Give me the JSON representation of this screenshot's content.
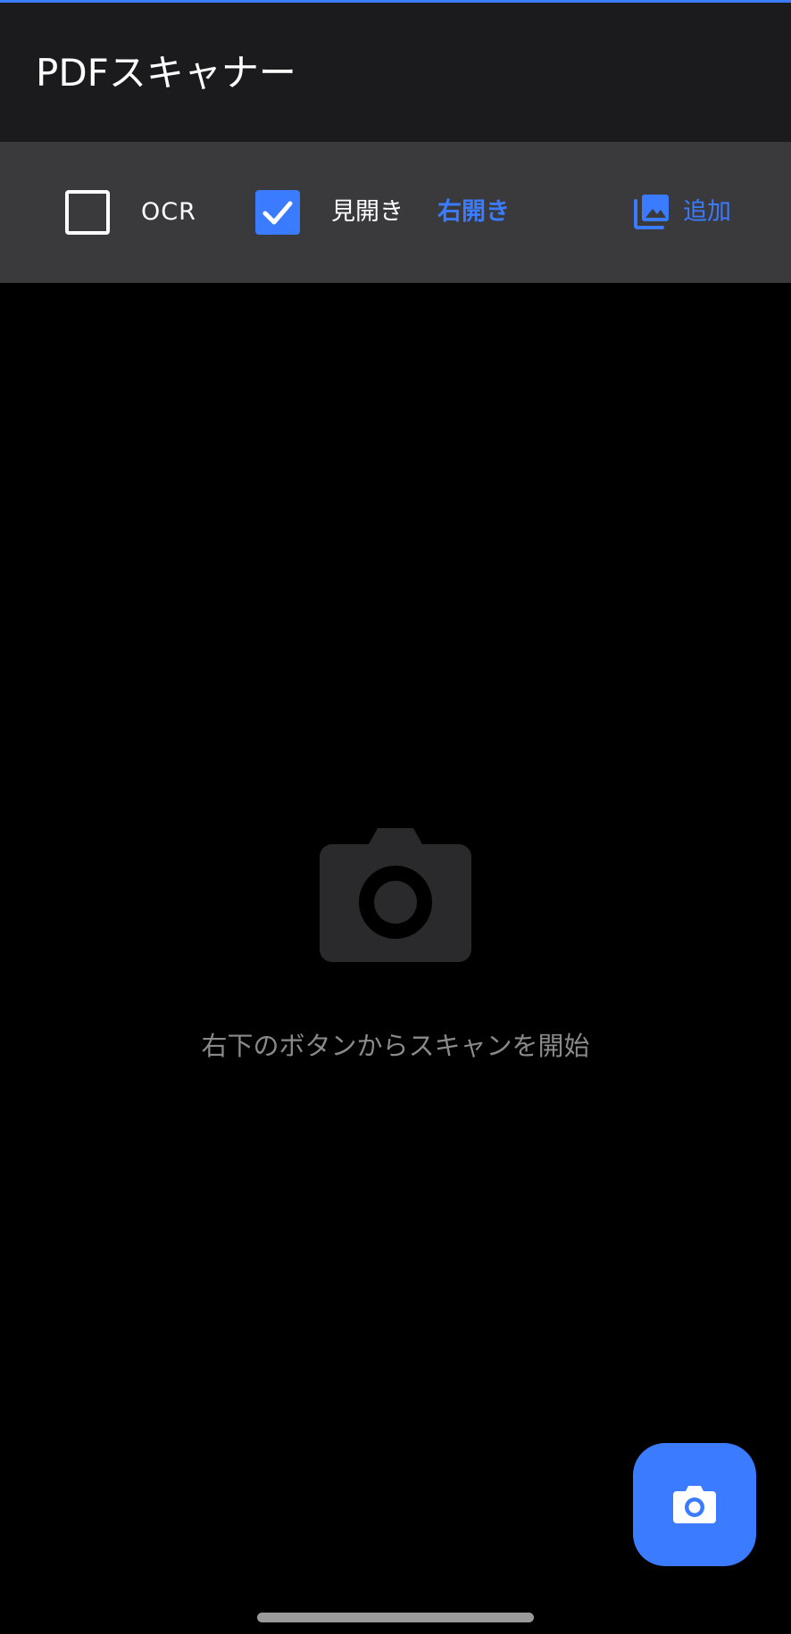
{
  "app_bar": {
    "title": "PDFスキャナー"
  },
  "toolbar": {
    "ocr": {
      "label": "OCR",
      "checked": false
    },
    "spread": {
      "label": "見開き",
      "checked": true
    },
    "binding_direction": {
      "label": "右開き"
    },
    "add": {
      "label": "追加",
      "icon": "photo-library-icon"
    }
  },
  "empty_state": {
    "icon": "camera-icon",
    "message": "右下のボタンからスキャンを開始"
  },
  "fab": {
    "icon": "camera-icon"
  },
  "colors": {
    "accent": "#3b7bff",
    "app_bar_bg": "#1b1b1d",
    "toolbar_bg": "#3a3a3c",
    "background": "#000000",
    "muted_text": "#8a8a8a",
    "empty_icon": "#2a2a2c"
  }
}
